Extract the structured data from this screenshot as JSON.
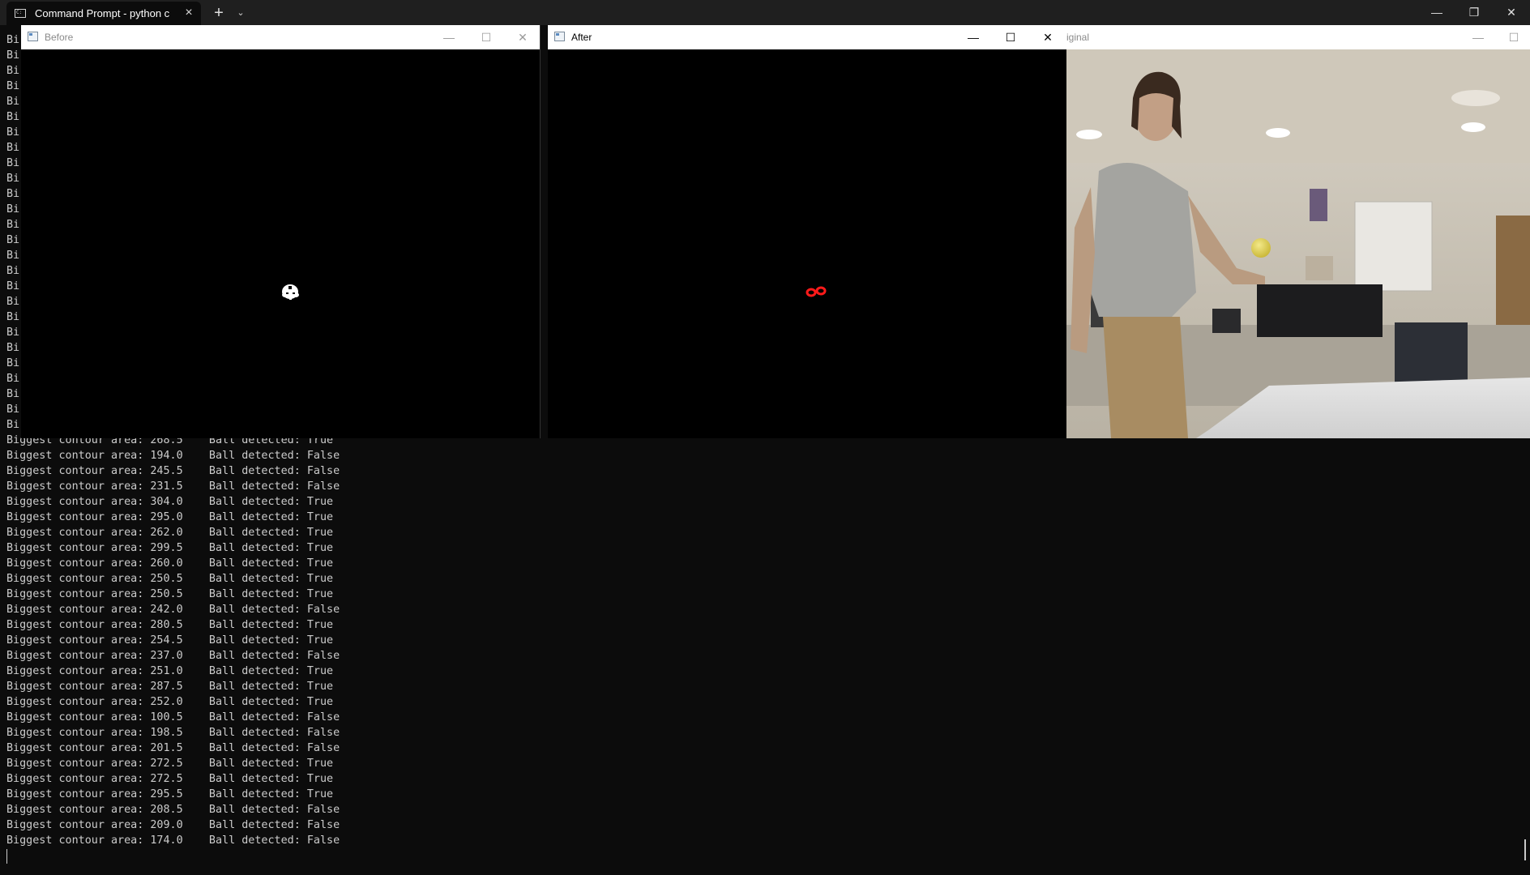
{
  "terminal": {
    "tab_title": "Command Prompt - python  c",
    "tab_close_glyph": "×",
    "new_tab_glyph": "+",
    "dropdown_glyph": "⌄",
    "window_buttons": {
      "minimize": "—",
      "restore": "❐",
      "close": "✕"
    },
    "hidden_line_prefix": "Bi",
    "hidden_line_count": 26,
    "lines": [
      "Biggest contour area: 268.5    Ball detected: True",
      "Biggest contour area: 194.0    Ball detected: False",
      "Biggest contour area: 245.5    Ball detected: False",
      "Biggest contour area: 231.5    Ball detected: False",
      "Biggest contour area: 304.0    Ball detected: True",
      "Biggest contour area: 295.0    Ball detected: True",
      "Biggest contour area: 262.0    Ball detected: True",
      "Biggest contour area: 299.5    Ball detected: True",
      "Biggest contour area: 260.0    Ball detected: True",
      "Biggest contour area: 250.5    Ball detected: True",
      "Biggest contour area: 250.5    Ball detected: True",
      "Biggest contour area: 242.0    Ball detected: False",
      "Biggest contour area: 280.5    Ball detected: True",
      "Biggest contour area: 254.5    Ball detected: True",
      "Biggest contour area: 237.0    Ball detected: False",
      "Biggest contour area: 251.0    Ball detected: True",
      "Biggest contour area: 287.5    Ball detected: True",
      "Biggest contour area: 252.0    Ball detected: True",
      "Biggest contour area: 100.5    Ball detected: False",
      "Biggest contour area: 198.5    Ball detected: False",
      "Biggest contour area: 201.5    Ball detected: False",
      "Biggest contour area: 272.5    Ball detected: True",
      "Biggest contour area: 272.5    Ball detected: True",
      "Biggest contour area: 295.5    Ball detected: True",
      "Biggest contour area: 208.5    Ball detected: False",
      "Biggest contour area: 209.0    Ball detected: False",
      "Biggest contour area: 174.0    Ball detected: False"
    ]
  },
  "windows": {
    "before": {
      "title": "Before",
      "minimize": "—",
      "maximize": "☐",
      "close": "✕"
    },
    "after": {
      "title": "After",
      "minimize": "—",
      "maximize": "☐",
      "close": "✕"
    },
    "original": {
      "title": "iginal",
      "minimize": "—",
      "maximize": "☐"
    }
  },
  "colors": {
    "terminal_bg": "#0c0c0c",
    "terminal_text": "#cccccc",
    "titlebar_bg": "#1f1f1f",
    "mask_white": "#ffffff",
    "contour_red": "#ff0000",
    "ball_yellow": "#e2d24a"
  },
  "icons": {
    "tab": "cmd-terminal-icon",
    "cv_window": "opencv-window-icon"
  }
}
